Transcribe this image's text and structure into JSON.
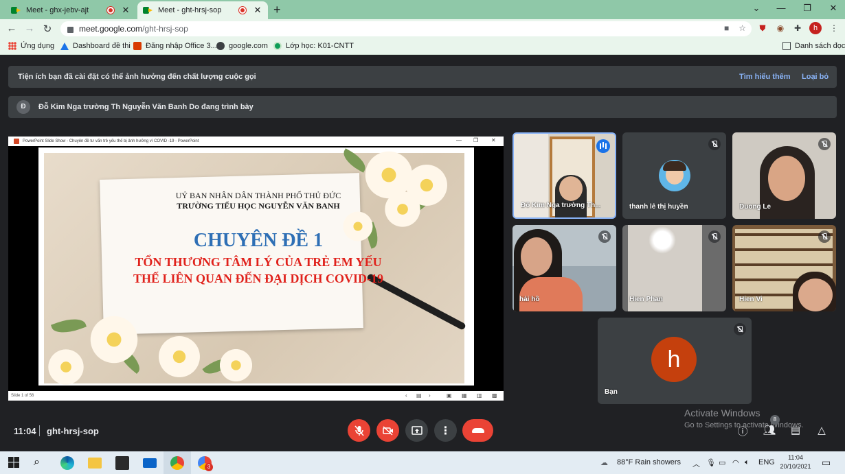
{
  "browser": {
    "tabs": [
      {
        "title": "Meet - ghx-jebv-ajt",
        "active": false
      },
      {
        "title": "Meet - ght-hrsj-sop",
        "active": true
      }
    ],
    "url_host": "meet.google.com",
    "url_path": "/ght-hrsj-sop",
    "profile_initial": "h",
    "bookmarks": [
      "Ứng dụng",
      "Dashboard đề thi",
      "Đăng nhập Office 3...",
      "google.com",
      "Lớp học: K01-CNTT"
    ],
    "reading_list": "Danh sách đọc"
  },
  "banners": {
    "extension_warning": "Tiện ích bạn đã cài đặt có thể ảnh hưởng đến chất lượng cuộc gọi",
    "learn_more": "Tìm hiểu thêm",
    "dismiss": "Loại bỏ",
    "presenter_initial": "Đ",
    "presenting": "Đỗ Kim Nga trường Th Nguyễn Văn Banh Do đang trình bày"
  },
  "presentation": {
    "window_title": "PowerPoint Slide Show  -  Chuyên đề tư vấn trẻ yếu thế bị ảnh hưởng vì COVID -19 - PowerPoint",
    "slide_line1": "UỶ BAN NHÂN DÂN THÀNH PHỐ THỦ ĐỨC",
    "slide_line2": "TRƯỜNG TIỂU HỌC NGUYỄN VĂN BANH",
    "slide_heading": "CHUYÊN ĐỀ 1",
    "slide_sub1": "TỔN THƯƠNG TÂM LÝ CỦA TRẺ EM YẾU",
    "slide_sub2": "THẾ LIÊN QUAN ĐẾN ĐẠI DỊCH COVID-19",
    "slide_counter": "Slide 1 of 56"
  },
  "participants": [
    {
      "name": "Đỗ Kim Nga trường Th...",
      "speaking": true
    },
    {
      "name": "thanh lê thị huyền",
      "muted": true
    },
    {
      "name": "Duong Le",
      "muted": true
    },
    {
      "name": "hải hồ",
      "muted": true
    },
    {
      "name": "Hien Phan",
      "muted": true
    },
    {
      "name": "Hien Vi",
      "muted": true
    },
    {
      "name": "Bạn",
      "muted": true,
      "initial": "h"
    }
  ],
  "bottom_bar": {
    "time": "11:04",
    "meeting_code": "ght-hrsj-sop",
    "people_count": "8",
    "watermark_title": "Activate Windows",
    "watermark_sub": "Go to Settings to activate Windows."
  },
  "taskbar": {
    "weather": "88°F  Rain showers",
    "language": "ENG",
    "time": "11:04",
    "date": "20/10/2021",
    "chrome_badge": "3"
  },
  "colors": {
    "tab_strip": "#8fc8a8",
    "meet_bg": "#202124",
    "tile_bg": "#3c4043",
    "accent_red": "#ea4335",
    "link_blue": "#8ab4f8",
    "slide_heading_blue": "#2e6fb5",
    "slide_sub_red": "#e0211b"
  }
}
